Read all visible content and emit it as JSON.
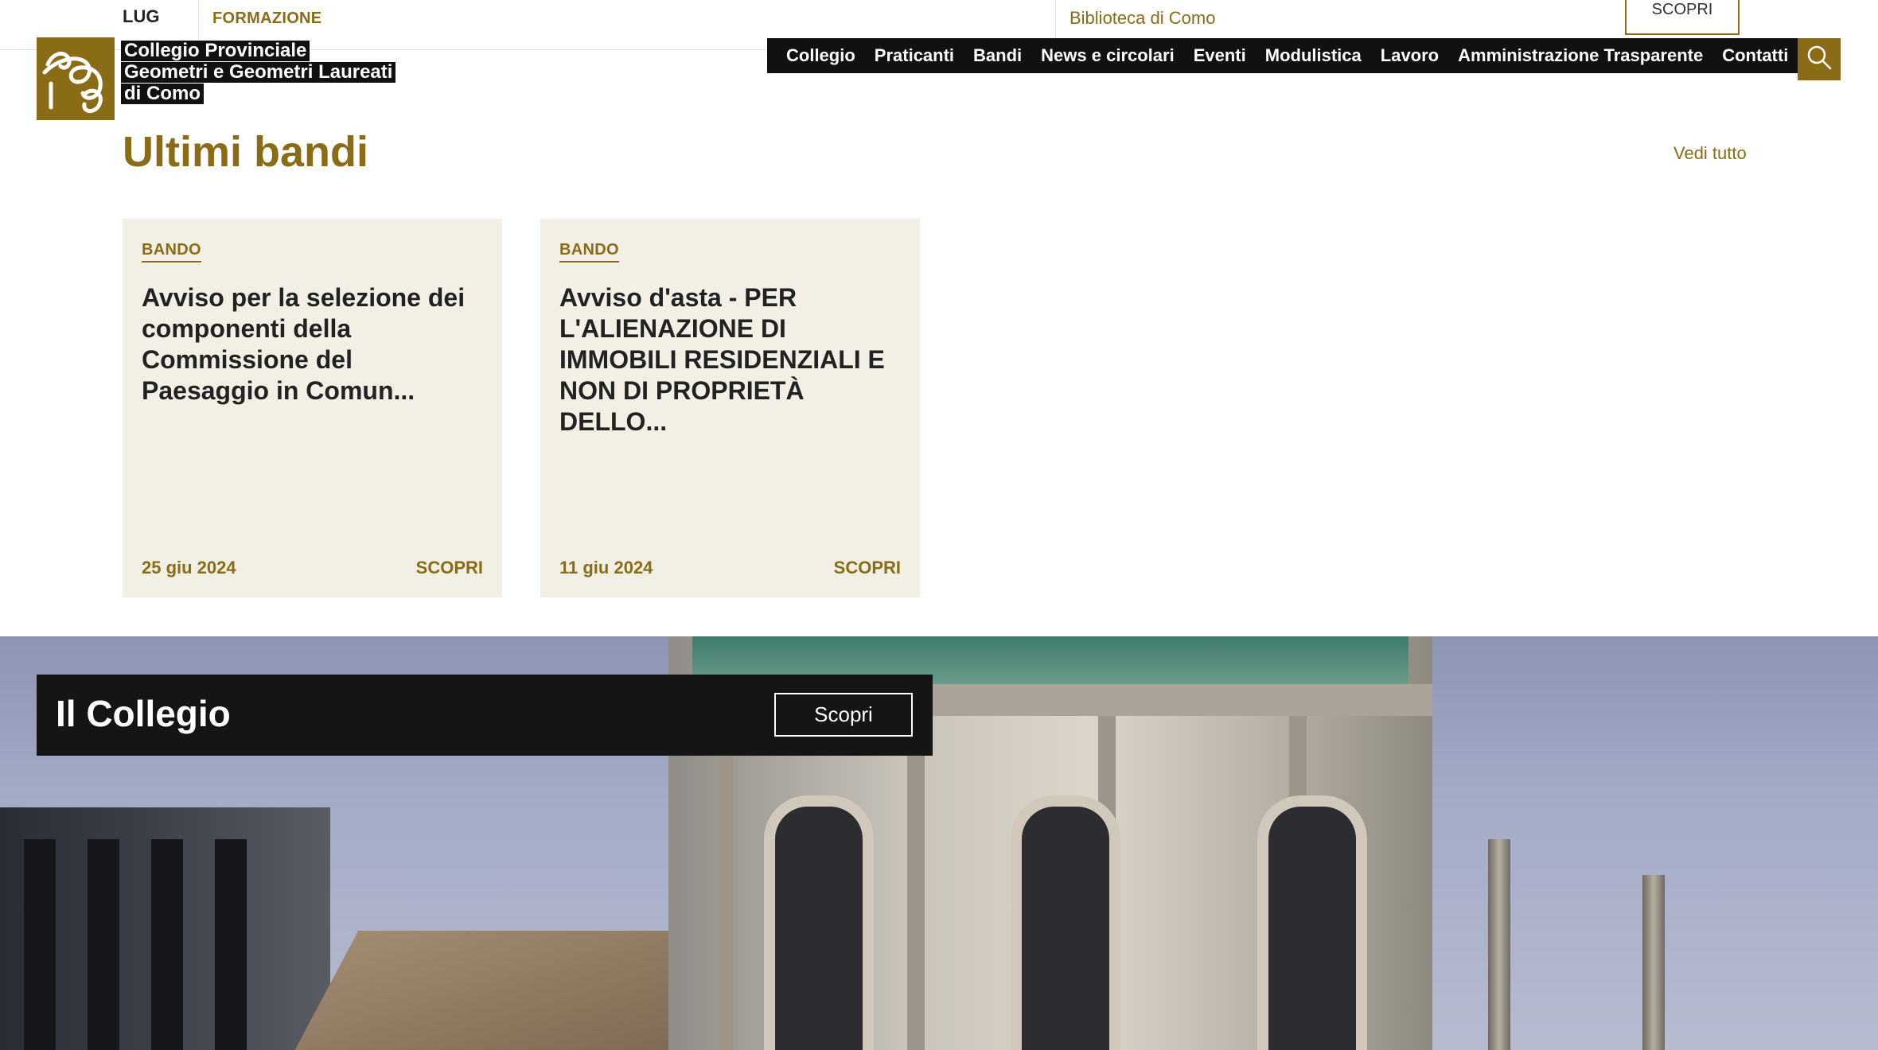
{
  "top_strip": {
    "date_month": "LUG",
    "event_category": "FORMAZIONE",
    "event_place": "Biblioteca di Como",
    "event_cta": "SCOPRI"
  },
  "logo": {
    "lines": [
      "Collegio Provinciale",
      "Geometri e Geometri Laureati",
      "di Como"
    ]
  },
  "nav": {
    "items": [
      "Collegio",
      "Praticanti",
      "Bandi",
      "News e circolari",
      "Eventi",
      "Modulistica",
      "Lavoro",
      "Amministrazione Trasparente",
      "Contatti"
    ]
  },
  "section": {
    "title": "Ultimi bandi",
    "see_all": "Vedi tutto"
  },
  "cards": [
    {
      "tag": "BANDO",
      "title": "Avviso per la selezione dei componenti della Commissione del Paesaggio in Comun...",
      "date": "25 giu 2024",
      "cta": "SCOPRI"
    },
    {
      "tag": "BANDO",
      "title": "Avviso d'asta - PER L'ALIENAZIONE DI IMMOBILI RESIDENZIALI E NON DI PROPRIETÀ DELLO...",
      "date": "11 giu 2024",
      "cta": "SCOPRI"
    }
  ],
  "hero": {
    "title": "Il Collegio",
    "cta": "Scopri"
  },
  "colors": {
    "brand_gold": "#8a6b16",
    "nav_bg": "#111111",
    "card_bg": "#f2efe5"
  },
  "icons": {
    "search": "search-icon",
    "logo": "cg-monogram-logo"
  }
}
